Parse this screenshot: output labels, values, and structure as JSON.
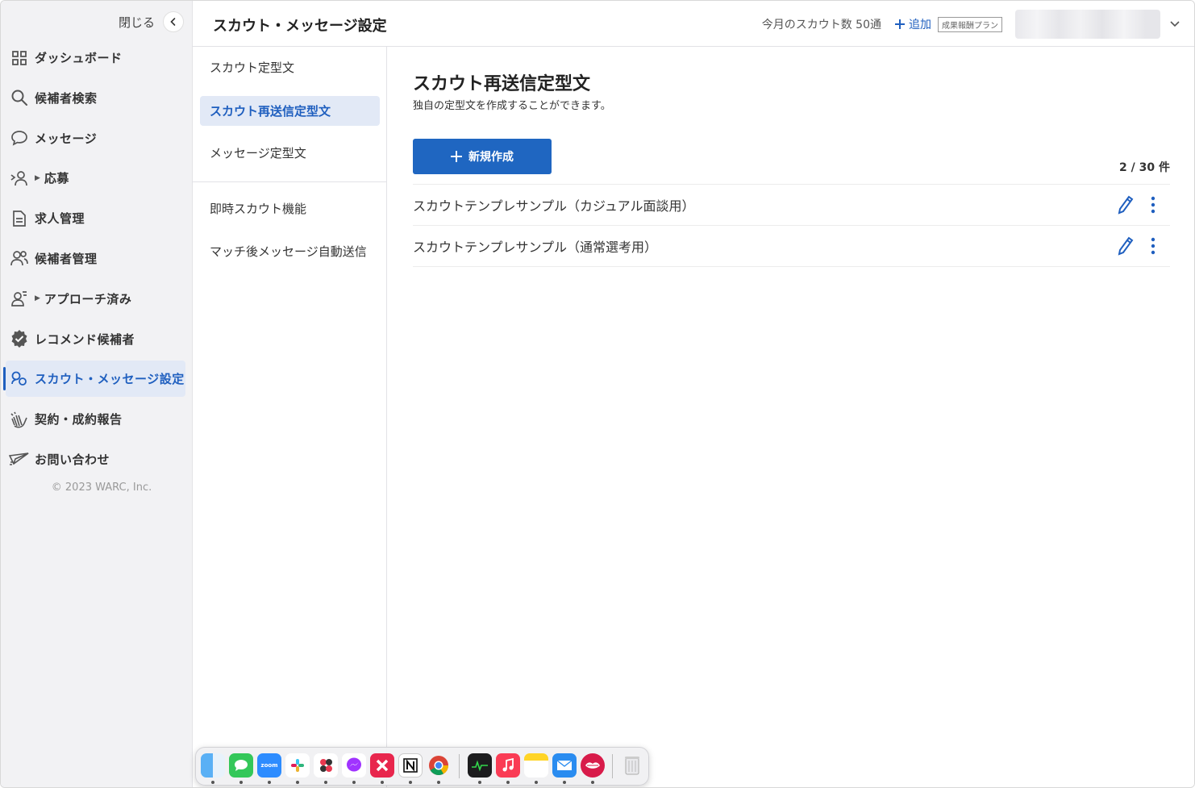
{
  "sidebar": {
    "close_label": "閉じる",
    "items": [
      {
        "label": "ダッシュボード",
        "icon": "dashboard-icon"
      },
      {
        "label": "候補者検索",
        "icon": "search-icon"
      },
      {
        "label": "メッセージ",
        "icon": "chat-bubble-icon"
      },
      {
        "label": "応募",
        "icon": "applicant-icon"
      },
      {
        "label": "求人管理",
        "icon": "document-icon"
      },
      {
        "label": "候補者管理",
        "icon": "users-icon"
      },
      {
        "label": "アプローチ済み",
        "icon": "person-lines-icon"
      },
      {
        "label": "レコメンド候補者",
        "icon": "verified-badge-icon"
      },
      {
        "label": "スカウト・メッセージ設定",
        "icon": "scout-settings-icon"
      },
      {
        "label": "契約・成約報告",
        "icon": "clapping-hands-icon"
      },
      {
        "label": "お問い合わせ",
        "icon": "paper-plane-icon"
      }
    ],
    "copyright": "© 2023 WARC, Inc."
  },
  "header": {
    "title": "スカウト・メッセージ設定",
    "scout_count": "今月のスカウト数 50通",
    "add_label": "追加",
    "plan_badge": "成果報酬プラン"
  },
  "subnav": {
    "items": [
      {
        "label": "スカウト定型文"
      },
      {
        "label": "スカウト再送信定型文"
      },
      {
        "label": "メッセージ定型文"
      },
      {
        "label": "即時スカウト機能"
      },
      {
        "label": "マッチ後メッセージ自動送信"
      }
    ]
  },
  "main": {
    "title": "スカウト再送信定型文",
    "description": "独自の定型文を作成することができます。",
    "new_button": "新規作成",
    "count": "2 / 30 件",
    "templates": [
      {
        "name": "スカウトテンプレサンプル（カジュアル面談用）"
      },
      {
        "name": "スカウトテンプレサンプル（通常選考用）"
      }
    ]
  },
  "dock": {
    "zoom_text": "zoom",
    "apps": [
      "finder",
      "messages",
      "zoom",
      "slack",
      "scrapbox",
      "messenger",
      "xmind",
      "notion",
      "chrome",
      "activity-monitor",
      "music",
      "notes",
      "mail",
      "lips-app",
      "trash"
    ]
  },
  "colors": {
    "accent": "#1f5fbf",
    "button": "#1f66c1",
    "active_bg": "#e2e9f6"
  }
}
